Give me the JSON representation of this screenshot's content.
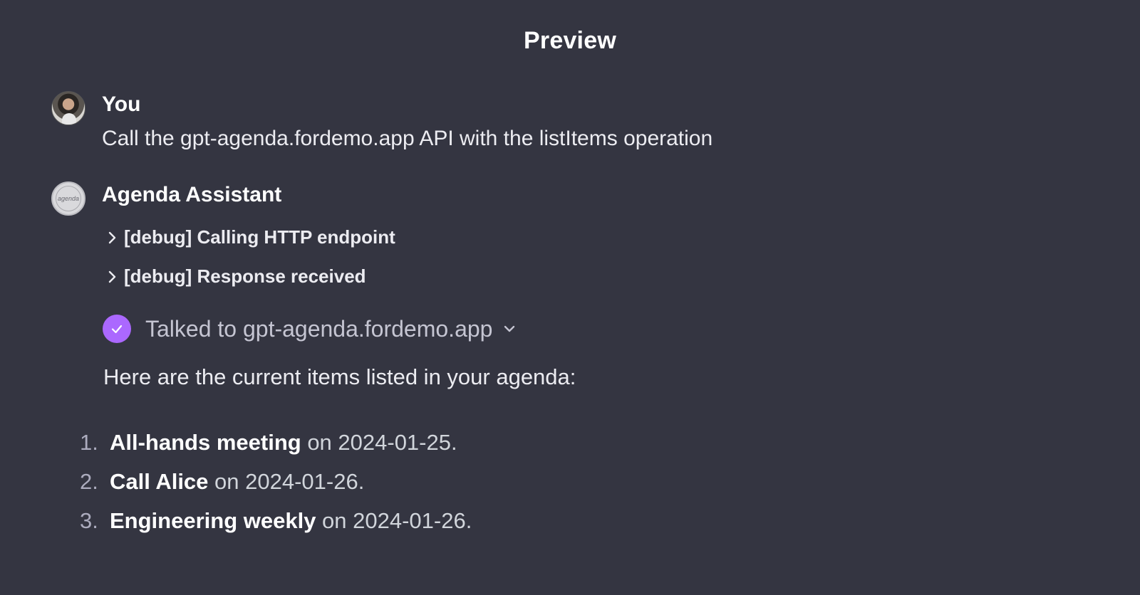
{
  "header": {
    "title": "Preview"
  },
  "user_message": {
    "sender": "You",
    "text": "Call the gpt-agenda.fordemo.app API with the listItems operation"
  },
  "assistant_message": {
    "sender": "Agenda Assistant",
    "avatar_text": "agenda",
    "debug_rows": [
      {
        "label": "[debug] Calling HTTP endpoint",
        "icon": "chevron-right-icon"
      },
      {
        "label": "[debug] Response received",
        "icon": "chevron-right-icon"
      }
    ],
    "tool_status": {
      "label": "Talked to gpt-agenda.fordemo.app",
      "icon": "check-icon",
      "accent_color": "#ab68ff"
    },
    "intro": "Here are the current items listed in your agenda:",
    "items": [
      {
        "number": "1.",
        "title": "All-hands meeting",
        "suffix": " on 2024-01-25."
      },
      {
        "number": "2.",
        "title": "Call Alice",
        "suffix": " on 2024-01-26."
      },
      {
        "number": "3.",
        "title": "Engineering weekly",
        "suffix": " on 2024-01-26."
      }
    ]
  },
  "colors": {
    "background": "#343541",
    "text": "#ececf1",
    "muted_text": "#c5c5d2"
  }
}
